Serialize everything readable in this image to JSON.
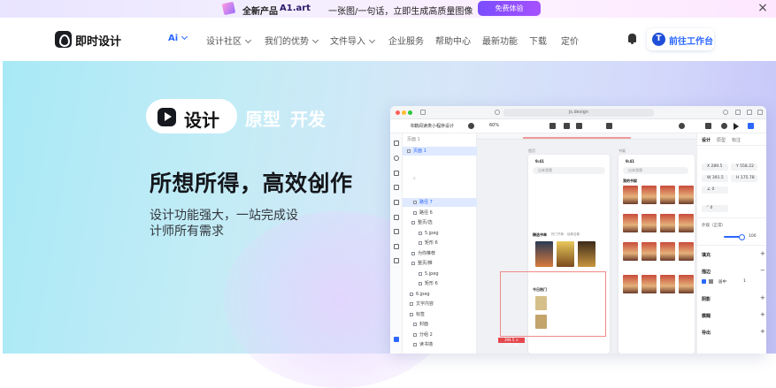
{
  "promo": {
    "product_label": "全新产品",
    "product_name": "A1.art",
    "tagline": "一张图/一句话，立即生成高质量图像",
    "cta": "免费体验"
  },
  "nav": {
    "brand": "即时设计",
    "items": [
      {
        "label": "Ai",
        "dropdown": true
      },
      {
        "label": "设计社区",
        "dropdown": true
      },
      {
        "label": "我们的优势",
        "dropdown": true
      },
      {
        "label": "文件导入",
        "dropdown": true
      },
      {
        "label": "企业服务",
        "dropdown": false
      },
      {
        "label": "帮助中心",
        "dropdown": false
      },
      {
        "label": "最新功能",
        "dropdown": false
      },
      {
        "label": "下载",
        "dropdown": false
      },
      {
        "label": "定价",
        "dropdown": false
      }
    ],
    "workspace_button": "前往工作台",
    "avatar_letter": "T"
  },
  "hero": {
    "pill_text": "设计",
    "tag_prototype": "原型",
    "tag_develop": "开发",
    "headline": "所想所得，高效创作",
    "sub_line1": "设计功能强大，一站完成设",
    "sub_line2": "计师所有需求"
  },
  "app": {
    "url": "js.design",
    "project_name": "书籍阅读类小程序设计",
    "zoom": "60%",
    "layers_header": "页面 1",
    "layers": [
      {
        "label": "页面 1",
        "selected": true
      },
      {
        "label": "路径 7",
        "selected": true
      },
      {
        "label": "路径 6",
        "selected": false
      },
      {
        "label": "整页/选",
        "selected": false
      },
      {
        "label": "5.jpeg",
        "selected": false
      },
      {
        "label": "矩形 6",
        "selected": false
      },
      {
        "label": "为你推荐",
        "selected": false
      },
      {
        "label": "整页/推",
        "selected": false
      },
      {
        "label": "5.jpeg",
        "selected": false
      },
      {
        "label": "矩形 6",
        "selected": false
      },
      {
        "label": "6.jpeg",
        "selected": false
      },
      {
        "label": "文字内容",
        "selected": false
      },
      {
        "label": "标签",
        "selected": false
      },
      {
        "label": "封面",
        "selected": false
      },
      {
        "label": "分组 2",
        "selected": false
      },
      {
        "label": "读书墙",
        "selected": false
      }
    ],
    "phone1_label": "首页",
    "phone2_label": "书架",
    "search_placeholder": "出来我猜",
    "section_picks": "精选书单",
    "section_new": "今日热门",
    "tab_labels": [
      "热门书单",
      "经典名著"
    ],
    "phone2_section": "我的书架",
    "red_size_label": "394.5 × 175.78",
    "props": {
      "tabs": [
        "设计",
        "原型",
        "标注"
      ],
      "x": "289.5",
      "y": "558.22",
      "w": "391.5",
      "h": "175.78",
      "rotation": "0",
      "radius": "0",
      "layer_label": "外观（正常）",
      "opacity": "100",
      "section_fill": "填充",
      "section_stroke": "描边",
      "stroke_align": "居中",
      "stroke_width": "1",
      "section_shadow": "阴影",
      "section_blur": "模糊",
      "section_export": "导出"
    }
  }
}
